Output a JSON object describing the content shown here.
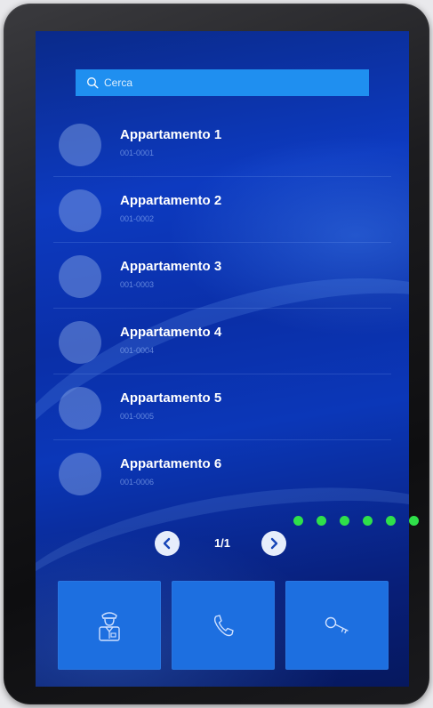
{
  "search": {
    "placeholder": "Cerca",
    "icon": "search-icon"
  },
  "apartments": [
    {
      "name": "Appartamento 1",
      "code": "001-0001"
    },
    {
      "name": "Appartamento 2",
      "code": "001-0002"
    },
    {
      "name": "Appartamento 3",
      "code": "001-0003"
    },
    {
      "name": "Appartamento 4",
      "code": "001-0004"
    },
    {
      "name": "Appartamento 5",
      "code": "001-0005"
    },
    {
      "name": "Appartamento 6",
      "code": "001-0006"
    }
  ],
  "pager": {
    "label": "1/1",
    "prev_icon": "chevron-left-icon",
    "next_icon": "chevron-right-icon"
  },
  "actions": [
    {
      "icon": "concierge-icon"
    },
    {
      "icon": "phone-icon"
    },
    {
      "icon": "key-icon"
    }
  ],
  "colors": {
    "search_bar": "#1f8ff0",
    "action_tile": "#1d6fe0",
    "indicator_dots": "#2fe04a",
    "pager_button": "#e6edfb"
  }
}
